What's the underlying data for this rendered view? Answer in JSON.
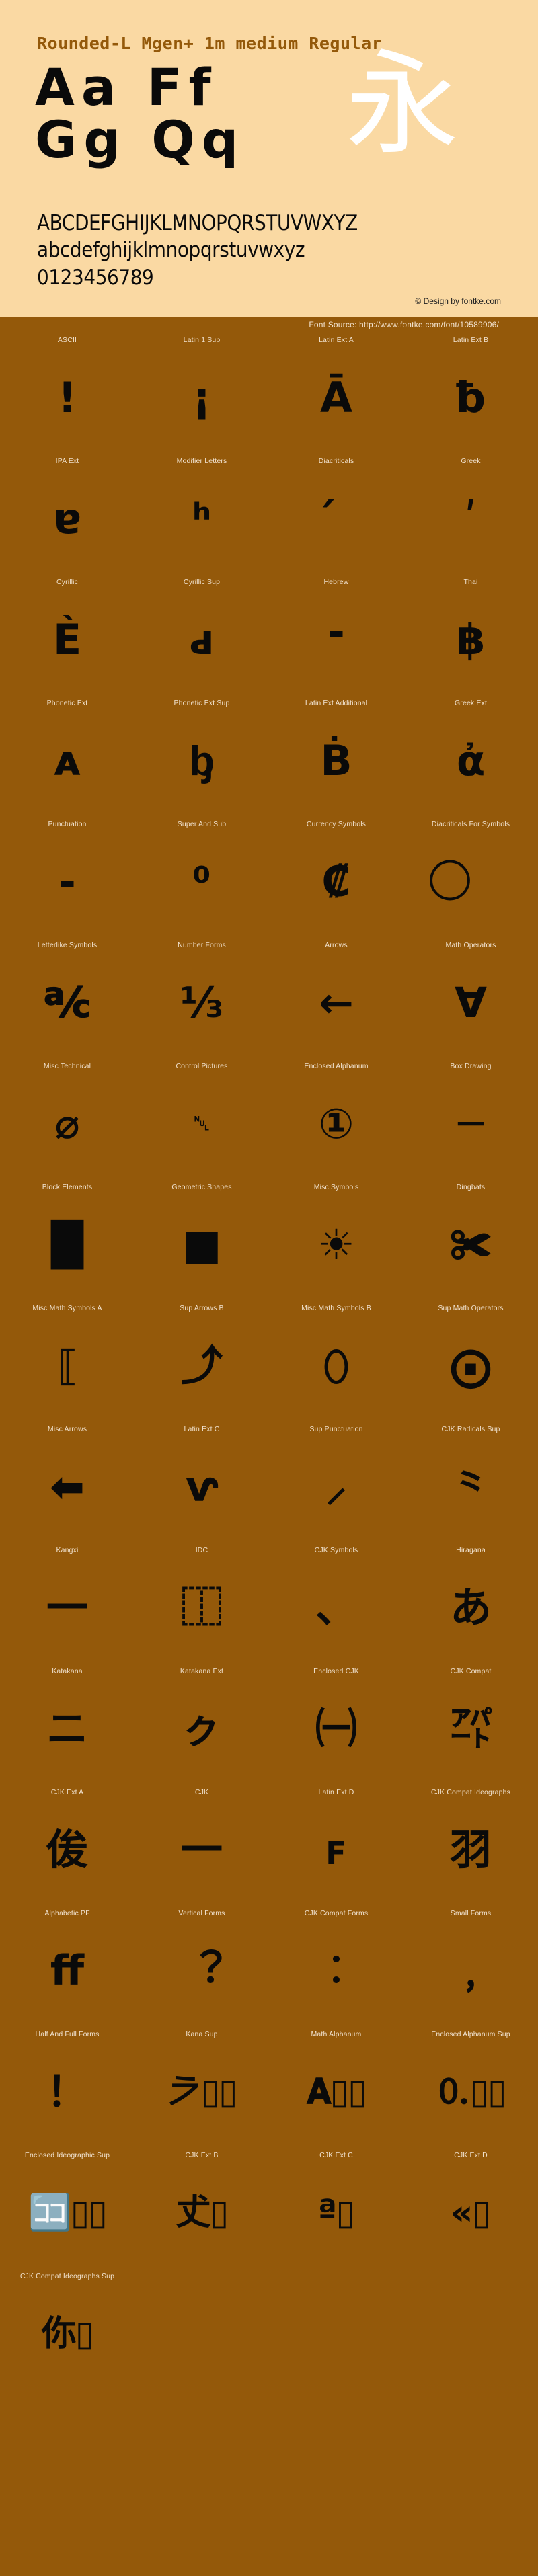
{
  "header": {
    "title": "Rounded-L Mgen+ 1m medium Regular",
    "sample_chars_line1": "Aa  Ff",
    "sample_chars_line2": "Gg  Qq",
    "cjk_sample": "永",
    "uppercase": "ABCDEFGHIJKLMNOPQRSTUVWXYZ",
    "lowercase": "abcdefghijklmnopqrstuvwxyz",
    "digits": "0123456789",
    "credit": "© Design by fontke.com"
  },
  "source_bar": {
    "text": "Font Source: http://www.fontke.com/font/10589906/"
  },
  "colors": {
    "hero_background": "#fad9a3",
    "page_background": "#94590a",
    "title": "#94590a",
    "glyph": "#0a0a0a",
    "label": "#f0e0cc",
    "cjk_hero": "#ffffff"
  },
  "blocks": [
    {
      "label": "ASCII",
      "glyph": "!",
      "size": ""
    },
    {
      "label": "Latin 1 Sup",
      "glyph": "¡",
      "size": ""
    },
    {
      "label": "Latin Ext A",
      "glyph": "Ā",
      "size": ""
    },
    {
      "label": "Latin Ext B",
      "glyph": "ƀ",
      "size": ""
    },
    {
      "label": "IPA Ext",
      "glyph": "ɐ",
      "size": ""
    },
    {
      "label": "Modifier Letters",
      "glyph": "ʰ",
      "size": ""
    },
    {
      "label": "Diacriticals",
      "glyph": "́",
      "size": ""
    },
    {
      "label": "Greek",
      "glyph": "ʹ",
      "size": ""
    },
    {
      "label": "Cyrillic",
      "glyph": "Ѐ",
      "size": ""
    },
    {
      "label": "Cyrillic Sup",
      "glyph": "ԁ",
      "size": ""
    },
    {
      "label": "Hebrew",
      "glyph": "־",
      "size": ""
    },
    {
      "label": "Thai",
      "glyph": "฿",
      "size": ""
    },
    {
      "label": "Phonetic Ext",
      "glyph": "ᴀ",
      "size": ""
    },
    {
      "label": "Phonetic Ext Sup",
      "glyph": "ᶀ",
      "size": ""
    },
    {
      "label": "Latin Ext Additional",
      "glyph": "Ḃ",
      "size": ""
    },
    {
      "label": "Greek Ext",
      "glyph": "ἀ",
      "size": ""
    },
    {
      "label": "Punctuation",
      "glyph": "‐",
      "size": ""
    },
    {
      "label": "Super And Sub",
      "glyph": "⁰",
      "size": ""
    },
    {
      "label": "Currency Symbols",
      "glyph": "₡",
      "size": ""
    },
    {
      "label": "Diacriticals For Symbols",
      "glyph": "⃝",
      "size": ""
    },
    {
      "label": "Letterlike Symbols",
      "glyph": "℀",
      "size": ""
    },
    {
      "label": "Number Forms",
      "glyph": "⅓",
      "size": ""
    },
    {
      "label": "Arrows",
      "glyph": "←",
      "size": ""
    },
    {
      "label": "Math Operators",
      "glyph": "∀",
      "size": ""
    },
    {
      "label": "Misc Technical",
      "glyph": "⌀",
      "size": ""
    },
    {
      "label": "Control Pictures",
      "glyph": "␀",
      "size": "tiny"
    },
    {
      "label": "Enclosed Alphanum",
      "glyph": "①",
      "size": ""
    },
    {
      "label": "Box Drawing",
      "glyph": "─",
      "size": ""
    },
    {
      "label": "Block Elements",
      "glyph": "█",
      "size": ""
    },
    {
      "label": "Geometric Shapes",
      "glyph": "■",
      "size": ""
    },
    {
      "label": "Misc Symbols",
      "glyph": "☀",
      "size": ""
    },
    {
      "label": "Dingbats",
      "glyph": "✀",
      "size": ""
    },
    {
      "label": "Misc Math Symbols A",
      "glyph": "⟦",
      "size": ""
    },
    {
      "label": "Sup Arrows B",
      "glyph": "⤴",
      "size": ""
    },
    {
      "label": "Misc Math Symbols B",
      "glyph": "⬯",
      "size": ""
    },
    {
      "label": "Sup Math Operators",
      "glyph": "⨀",
      "size": ""
    },
    {
      "label": "Misc Arrows",
      "glyph": "⬅",
      "size": ""
    },
    {
      "label": "Latin Ext C",
      "glyph": "ⱱ",
      "size": ""
    },
    {
      "label": "Sup Punctuation",
      "glyph": "⸝",
      "size": ""
    },
    {
      "label": "CJK Radicals Sup",
      "glyph": "⺀",
      "size": ""
    },
    {
      "label": "Kangxi",
      "glyph": "⼀",
      "size": ""
    },
    {
      "label": "IDC",
      "glyph": "⿰",
      "size": ""
    },
    {
      "label": "CJK Symbols",
      "glyph": "、",
      "size": ""
    },
    {
      "label": "Hiragana",
      "glyph": "あ",
      "size": ""
    },
    {
      "label": "Katakana",
      "glyph": "ニ",
      "size": ""
    },
    {
      "label": "Katakana Ext",
      "glyph": "ㇰ",
      "size": ""
    },
    {
      "label": "Enclosed CJK",
      "glyph": "㈠",
      "size": ""
    },
    {
      "label": "CJK Compat",
      "glyph": "㌀",
      "size": ""
    },
    {
      "label": "CJK Ext A",
      "glyph": "㑓",
      "size": ""
    },
    {
      "label": "CJK",
      "glyph": "一",
      "size": ""
    },
    {
      "label": "Latin Ext D",
      "glyph": "ꜰ",
      "size": ""
    },
    {
      "label": "CJK Compat Ideographs",
      "glyph": "羽",
      "size": ""
    },
    {
      "label": "Alphabetic PF",
      "glyph": "ﬀ",
      "size": ""
    },
    {
      "label": "Vertical Forms",
      "glyph": "︖",
      "size": ""
    },
    {
      "label": "CJK Compat Forms",
      "glyph": "︰",
      "size": ""
    },
    {
      "label": "Small Forms",
      "glyph": "﹐",
      "size": ""
    },
    {
      "label": "Half And Full Forms",
      "glyph": "！",
      "size": ""
    },
    {
      "label": "Kana Sup",
      "glyph": "𛀀▯▯",
      "size": "wide"
    },
    {
      "label": "Math Alphanum",
      "glyph": "𝐀▯▯",
      "size": "wide"
    },
    {
      "label": "Enclosed Alphanum Sup",
      "glyph": "🄀▯▯",
      "size": "wide"
    },
    {
      "label": "Enclosed Ideographic Sup",
      "glyph": "🈁▯▯",
      "size": "wide"
    },
    {
      "label": "CJK Ext B",
      "glyph": "𠀋▯",
      "size": "wide"
    },
    {
      "label": "CJK Ext C",
      "glyph": "𪜀ª▯",
      "size": "wide"
    },
    {
      "label": "CJK Ext D",
      "glyph": "𫠝«▯",
      "size": "wide"
    },
    {
      "label": "CJK Compat Ideographs Sup",
      "glyph": "你▯",
      "size": "wide"
    }
  ]
}
